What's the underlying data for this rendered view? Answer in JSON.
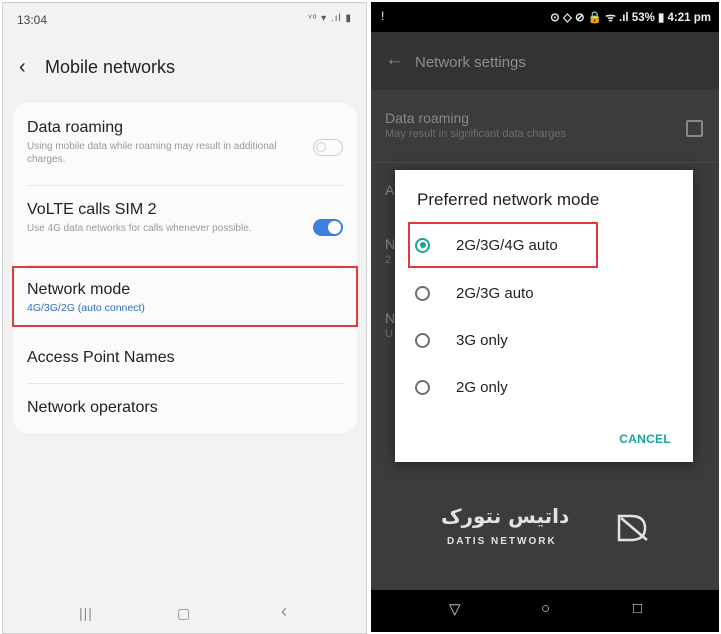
{
  "left_phone": {
    "status_time": "13:04",
    "status_icons": "ᵛᵒ ▾ .ıl ▮",
    "header_title": "Mobile networks",
    "items": [
      {
        "title": "Data roaming",
        "subtitle": "Using mobile data while roaming may result in additional charges.",
        "toggle": "off"
      },
      {
        "title": "VoLTE calls SIM 2",
        "subtitle": "Use 4G data networks for calls whenever possible.",
        "toggle": "on"
      },
      {
        "title": "Network mode",
        "subtitle": "4G/3G/2G (auto connect)"
      },
      {
        "title": "Access Point Names"
      },
      {
        "title": "Network operators"
      }
    ],
    "nav": {
      "recents": "|||",
      "home": "▢",
      "back": "‹"
    }
  },
  "right_phone": {
    "status_right": "⊙ ◇ ⊘  🔒 ᯤ .ıl 53% ▮ 4:21 pm",
    "status_left": "!",
    "toolbar_title": "Network settings",
    "bg_items": [
      {
        "title": "Data roaming",
        "subtitle": "May result in significant data charges"
      },
      {
        "title": "A"
      },
      {
        "title": "N",
        "subtitle": "2"
      },
      {
        "title": "N",
        "subtitle": "U"
      }
    ],
    "dialog": {
      "title": "Preferred network mode",
      "options": [
        {
          "label": "2G/3G/4G auto",
          "selected": true
        },
        {
          "label": "2G/3G auto",
          "selected": false
        },
        {
          "label": "3G only",
          "selected": false
        },
        {
          "label": "2G only",
          "selected": false
        }
      ],
      "cancel_label": "CANCEL"
    },
    "watermark": {
      "persian": "داتیس نتورک",
      "english": "DATIS NETWORK"
    },
    "nav": {
      "back": "▽",
      "home": "○",
      "recents": "□"
    }
  },
  "colors": {
    "highlight": "#e03a3a",
    "accent_teal": "#17a79a",
    "toggle_blue": "#3d7fe0",
    "link_blue": "#2c6fc0"
  }
}
